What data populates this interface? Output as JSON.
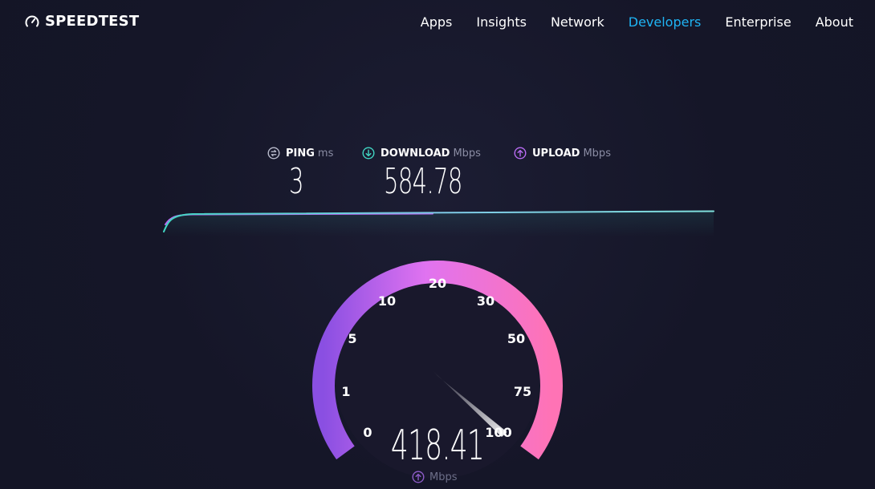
{
  "header": {
    "logo_text": "SPEEDTEST",
    "nav": [
      {
        "label": "Apps",
        "active": false
      },
      {
        "label": "Insights",
        "active": false
      },
      {
        "label": "Network",
        "active": false
      },
      {
        "label": "Developers",
        "active": true
      },
      {
        "label": "Enterprise",
        "active": false
      },
      {
        "label": "About",
        "active": false
      }
    ]
  },
  "stats": {
    "ping": {
      "label": "PING",
      "unit": "ms",
      "value": "3",
      "icon": "ping-icon"
    },
    "download": {
      "label": "DOWNLOAD",
      "unit": "Mbps",
      "value": "584.78",
      "icon": "download-arrow-icon"
    },
    "upload": {
      "label": "UPLOAD",
      "unit": "Mbps",
      "value": "",
      "icon": "upload-arrow-icon"
    }
  },
  "gauge": {
    "value": "418.41",
    "unit": "Mbps",
    "unit_icon": "upload-arrow-icon",
    "scale_labels": [
      "0",
      "1",
      "5",
      "10",
      "20",
      "30",
      "50",
      "75",
      "100"
    ],
    "needle_value": 100
  },
  "colors": {
    "background": "#151628",
    "accent_active": "#1fb4f4",
    "download": "#41d6c3",
    "upload": "#b86bf2",
    "gauge_start": "#8a4fe2",
    "gauge_end": "#ff73b5"
  }
}
